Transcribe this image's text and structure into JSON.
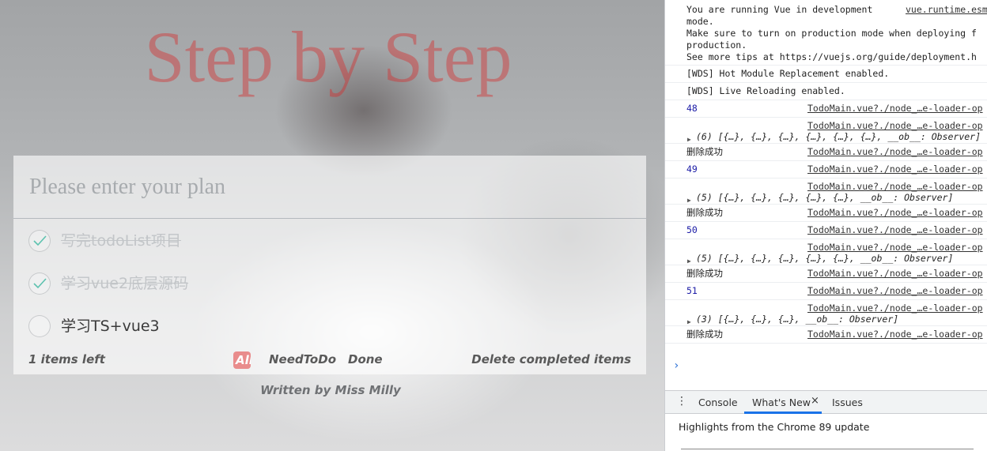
{
  "app": {
    "title": "Step by Step",
    "input_placeholder": "Please enter your plan",
    "todos": [
      {
        "label": "写完todoList项目",
        "done": true
      },
      {
        "label": "学习vue2底层源码",
        "done": true
      },
      {
        "label": "学习TS+vue3",
        "done": false
      }
    ],
    "footer": {
      "items_left": "1 items left",
      "filters": {
        "all": "All",
        "need": "NeedToDo",
        "done": "Done"
      },
      "clear": "Delete completed items"
    },
    "credit": "Written by Miss Milly",
    "colors": {
      "title": "#d62a2a",
      "active_filter": "#e98c8c",
      "check": "#5dc2af"
    }
  },
  "devtools": {
    "log": [
      {
        "type": "warn",
        "lines": [
          "You are running Vue in development",
          "mode.",
          "Make sure to turn on production mode when deploying f",
          "production.",
          "See more tips at https://vuejs.org/guide/deployment.h"
        ],
        "src": "vue.runtime.esm"
      },
      {
        "type": "text",
        "msg": "[WDS] Hot Module Replacement enabled.",
        "src": ""
      },
      {
        "type": "text",
        "msg": "[WDS] Live Reloading enabled.",
        "src": ""
      },
      {
        "type": "num",
        "msg": "48",
        "src": "TodoMain.vue?./node_…e-loader-op"
      },
      {
        "type": "obj",
        "msg": "(6) [{…}, {…}, {…}, {…}, {…}, {…}, __ob__: Observer]",
        "src": "TodoMain.vue?./node_…e-loader-op"
      },
      {
        "type": "text",
        "msg": "删除成功",
        "src": "TodoMain.vue?./node_…e-loader-op"
      },
      {
        "type": "num",
        "msg": "49",
        "src": "TodoMain.vue?./node_…e-loader-op"
      },
      {
        "type": "obj",
        "msg": "(5) [{…}, {…}, {…}, {…}, {…}, __ob__: Observer]",
        "src": "TodoMain.vue?./node_…e-loader-op"
      },
      {
        "type": "text",
        "msg": "删除成功",
        "src": "TodoMain.vue?./node_…e-loader-op"
      },
      {
        "type": "num",
        "msg": "50",
        "src": "TodoMain.vue?./node_…e-loader-op"
      },
      {
        "type": "obj",
        "msg": "(5) [{…}, {…}, {…}, {…}, {…}, __ob__: Observer]",
        "src": "TodoMain.vue?./node_…e-loader-op"
      },
      {
        "type": "text",
        "msg": "删除成功",
        "src": "TodoMain.vue?./node_…e-loader-op"
      },
      {
        "type": "num",
        "msg": "51",
        "src": "TodoMain.vue?./node_…e-loader-op"
      },
      {
        "type": "obj",
        "msg": "(3) [{…}, {…}, {…}, __ob__: Observer]",
        "src": "TodoMain.vue?./node_…e-loader-op"
      },
      {
        "type": "text",
        "msg": "删除成功",
        "src": "TodoMain.vue?./node_…e-loader-op"
      }
    ],
    "drawer": {
      "tabs": {
        "console": "Console",
        "whats_new": "What's New",
        "issues": "Issues"
      },
      "close": "×",
      "highlights": "Highlights from the Chrome 89 update"
    },
    "prompt": "›"
  }
}
